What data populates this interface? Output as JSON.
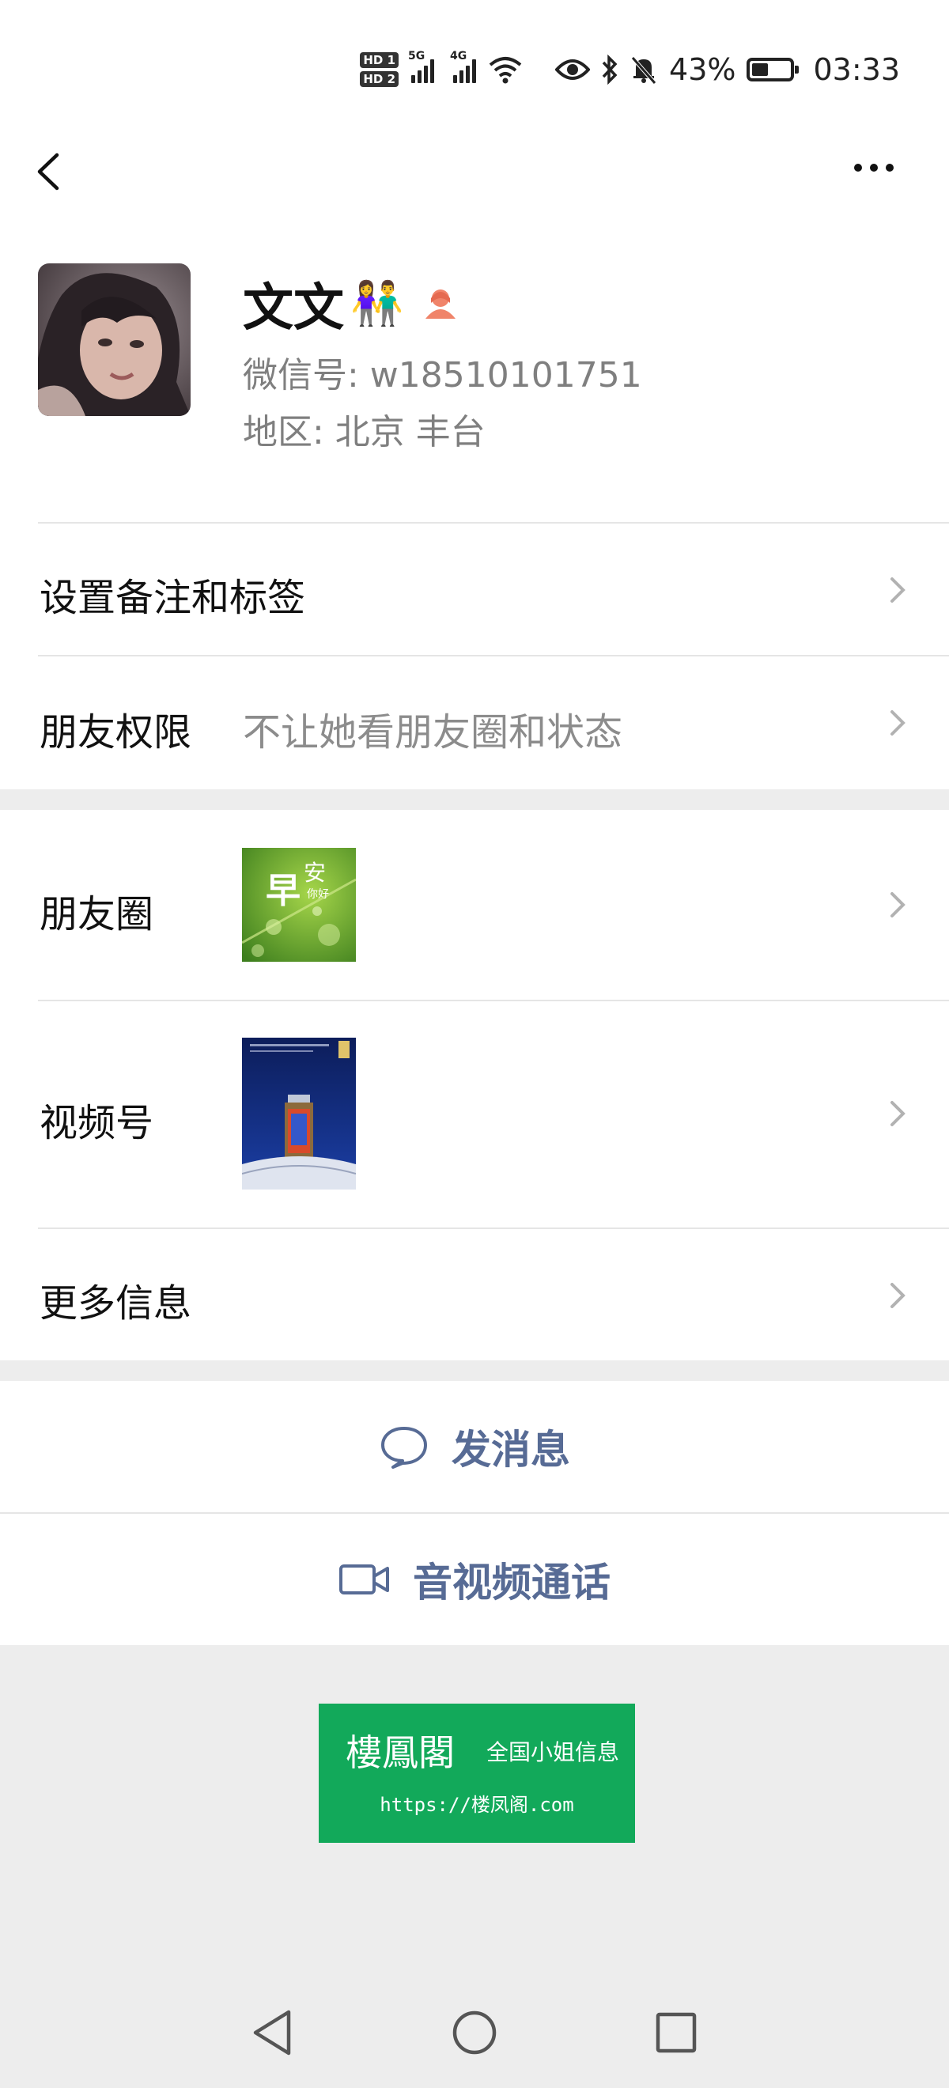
{
  "status_bar": {
    "hd1": "HD 1",
    "hd2": "HD 2",
    "net1": "5G",
    "net2": "4G",
    "wifi": "6",
    "battery": "43%",
    "battery_level": 0.43,
    "time": "03:33"
  },
  "profile": {
    "name": "文文",
    "emoji": "👫",
    "wechat_id": "微信号:  w18510101751",
    "region": "地区:  北京  丰台"
  },
  "rows": {
    "remark_tags": "设置备注和标签",
    "friend_permission_label": "朋友权限",
    "friend_permission_value": "不让她看朋友圈和状态",
    "moments": "朋友圈",
    "channels": "视频号",
    "more_info": "更多信息"
  },
  "moments_thumb": {
    "big": "早",
    "small": "安",
    "tiny": "你好"
  },
  "actions": {
    "send_message": "发消息",
    "av_call": "音视频通话"
  },
  "ad": {
    "title": "樓鳳閣",
    "subtitle": "全国小姐信息",
    "url": "https://楼凤阁.com"
  },
  "colors": {
    "link_blue": "#576b95",
    "ad_green": "#12a95a",
    "page_gray": "#ededed"
  }
}
